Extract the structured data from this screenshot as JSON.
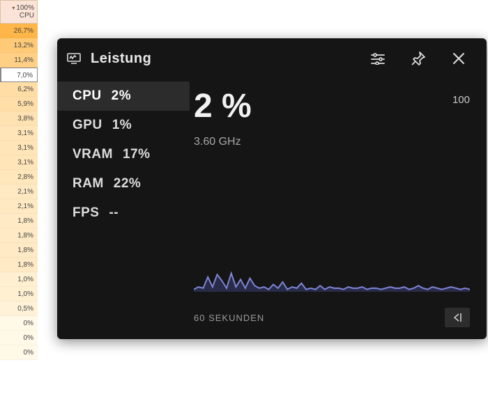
{
  "cpu_column": {
    "header_pct": "100%",
    "header_label": "CPU",
    "rows": [
      {
        "value": "26,7%",
        "shade": 1.0
      },
      {
        "value": "13,2%",
        "shade": 0.7
      },
      {
        "value": "11,4%",
        "shade": 0.62
      },
      {
        "value": "7,0%",
        "shade": 0.0,
        "selected": true
      },
      {
        "value": "6,2%",
        "shade": 0.42
      },
      {
        "value": "5,9%",
        "shade": 0.4
      },
      {
        "value": "3,8%",
        "shade": 0.34
      },
      {
        "value": "3,1%",
        "shade": 0.3
      },
      {
        "value": "3,1%",
        "shade": 0.3
      },
      {
        "value": "3,1%",
        "shade": 0.3
      },
      {
        "value": "2,8%",
        "shade": 0.28
      },
      {
        "value": "2,1%",
        "shade": 0.24
      },
      {
        "value": "2,1%",
        "shade": 0.24
      },
      {
        "value": "1,8%",
        "shade": 0.22
      },
      {
        "value": "1,8%",
        "shade": 0.22
      },
      {
        "value": "1,8%",
        "shade": 0.22
      },
      {
        "value": "1,8%",
        "shade": 0.22
      },
      {
        "value": "1,0%",
        "shade": 0.14
      },
      {
        "value": "1,0%",
        "shade": 0.14
      },
      {
        "value": "0,5%",
        "shade": 0.1
      },
      {
        "value": "0%",
        "shade": 0.0
      },
      {
        "value": "0%",
        "shade": 0.0
      },
      {
        "value": "0%",
        "shade": 0.0
      }
    ]
  },
  "overlay": {
    "title": "Leistung",
    "metrics": [
      {
        "name": "CPU",
        "value": "2%",
        "selected": true
      },
      {
        "name": "GPU",
        "value": "1%",
        "selected": false
      },
      {
        "name": "VRAM",
        "value": "17%",
        "selected": false
      },
      {
        "name": "RAM",
        "value": "22%",
        "selected": false
      },
      {
        "name": "FPS",
        "value": "--",
        "selected": false
      }
    ],
    "big_value": "2 %",
    "top_scale": "100",
    "freq": "3.60 GHz",
    "time_label": "60 SEKUNDEN",
    "bottom_scale": "0"
  },
  "colors": {
    "heat_low": "#fff9e8",
    "heat_high": "#ffb648",
    "chart_line": "#7f86d8",
    "chart_fill": "#3a3f72"
  },
  "chart_data": {
    "type": "area",
    "title": "CPU",
    "xlabel": "60 SEKUNDEN",
    "ylabel": "",
    "ylim": [
      0,
      100
    ],
    "x": [
      0,
      1,
      2,
      3,
      4,
      5,
      6,
      7,
      8,
      9,
      10,
      11,
      12,
      13,
      14,
      15,
      16,
      17,
      18,
      19,
      20,
      21,
      22,
      23,
      24,
      25,
      26,
      27,
      28,
      29,
      30,
      31,
      32,
      33,
      34,
      35,
      36,
      37,
      38,
      39,
      40,
      41,
      42,
      43,
      44,
      45,
      46,
      47,
      48,
      49,
      50,
      51,
      52,
      53,
      54,
      55,
      56,
      57,
      58,
      59
    ],
    "series": [
      {
        "name": "CPU %",
        "values": [
          2,
          4,
          3,
          12,
          4,
          14,
          9,
          3,
          15,
          4,
          10,
          3,
          11,
          5,
          3,
          4,
          2,
          6,
          3,
          8,
          2,
          4,
          3,
          7,
          2,
          3,
          2,
          5,
          2,
          4,
          3,
          3,
          2,
          4,
          3,
          3,
          4,
          2,
          3,
          3,
          2,
          3,
          4,
          3,
          3,
          4,
          2,
          3,
          5,
          3,
          2,
          4,
          3,
          2,
          3,
          4,
          3,
          2,
          3,
          2
        ]
      }
    ]
  }
}
